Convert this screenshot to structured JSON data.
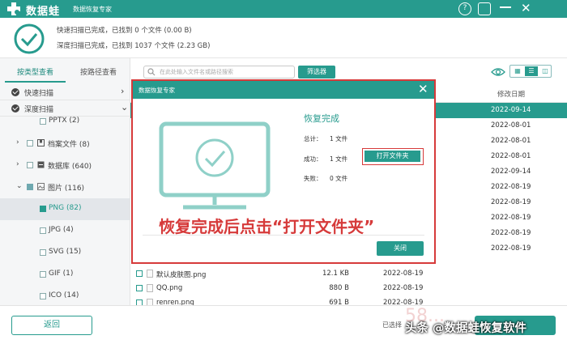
{
  "app": {
    "brand": "数据蛙",
    "subtitle": "数据恢复专家",
    "minimize": "—",
    "close": "✕",
    "help": "?",
    "restore": "▢"
  },
  "status": {
    "line1": "快速扫描已完成，已找到 0 个文件 (0.00  B)",
    "line2": "深度扫描已完成，已找到 1037 个文件 (2.23 GB)"
  },
  "sidebar": {
    "tabs": [
      "按类型查看",
      "按路径查看"
    ],
    "scans": [
      {
        "label": "快速扫描",
        "chev": "›"
      },
      {
        "label": "深度扫描",
        "chev": "⌄"
      }
    ],
    "tree": [
      {
        "label": "PPTX (2)"
      },
      {
        "arrow": "›",
        "label": "档案文件 (8)"
      },
      {
        "arrow": "›",
        "label": "数据库 (640)"
      },
      {
        "arrow": "⌄",
        "label": "图片 (116)"
      },
      {
        "label": "PNG (82)"
      },
      {
        "label": "JPG (4)"
      },
      {
        "label": "SVG (15)"
      },
      {
        "label": "GIF (1)"
      },
      {
        "label": "ICO (14)"
      }
    ]
  },
  "toolbar": {
    "search_placeholder": "在此处输入文件名或路径搜索",
    "filter_label": "筛选器"
  },
  "table": {
    "header_date": "修改日期",
    "dates": [
      "2022-09-14",
      "2022-08-01",
      "2022-08-01",
      "2022-08-01",
      "2022-09-14",
      "2022-08-19",
      "2022-08-19",
      "2022-08-19",
      "2022-08-19",
      "2022-08-19"
    ],
    "files": [
      {
        "name": "默认皮肤图.png",
        "size": "12.1 KB",
        "date": "2022-08-19"
      },
      {
        "name": "QQ.png",
        "size": "880  B",
        "date": "2022-08-19"
      },
      {
        "name": "renren.png",
        "size": "691  B",
        "date": "2022-08-19"
      }
    ]
  },
  "dialog": {
    "title": "数据恢复专家",
    "close": "✕",
    "heading": "恢复完成",
    "total_label": "总计：",
    "total_value": "1 文件",
    "success_label": "成功：",
    "success_value": "1 文件",
    "fail_label": "失败：",
    "fail_value": "0 文件",
    "open_folder": "打开文件夹",
    "close_button": "关闭"
  },
  "annotation": "恢复完成后点击“打开文件夹”",
  "footer": {
    "back": "返回",
    "selected": "已选择",
    "watermark": "头条 @数据蛙恢复软件",
    "watermark_num": "58..."
  },
  "colors": {
    "accent": "#279b8e",
    "highlight": "#d63a3a"
  }
}
